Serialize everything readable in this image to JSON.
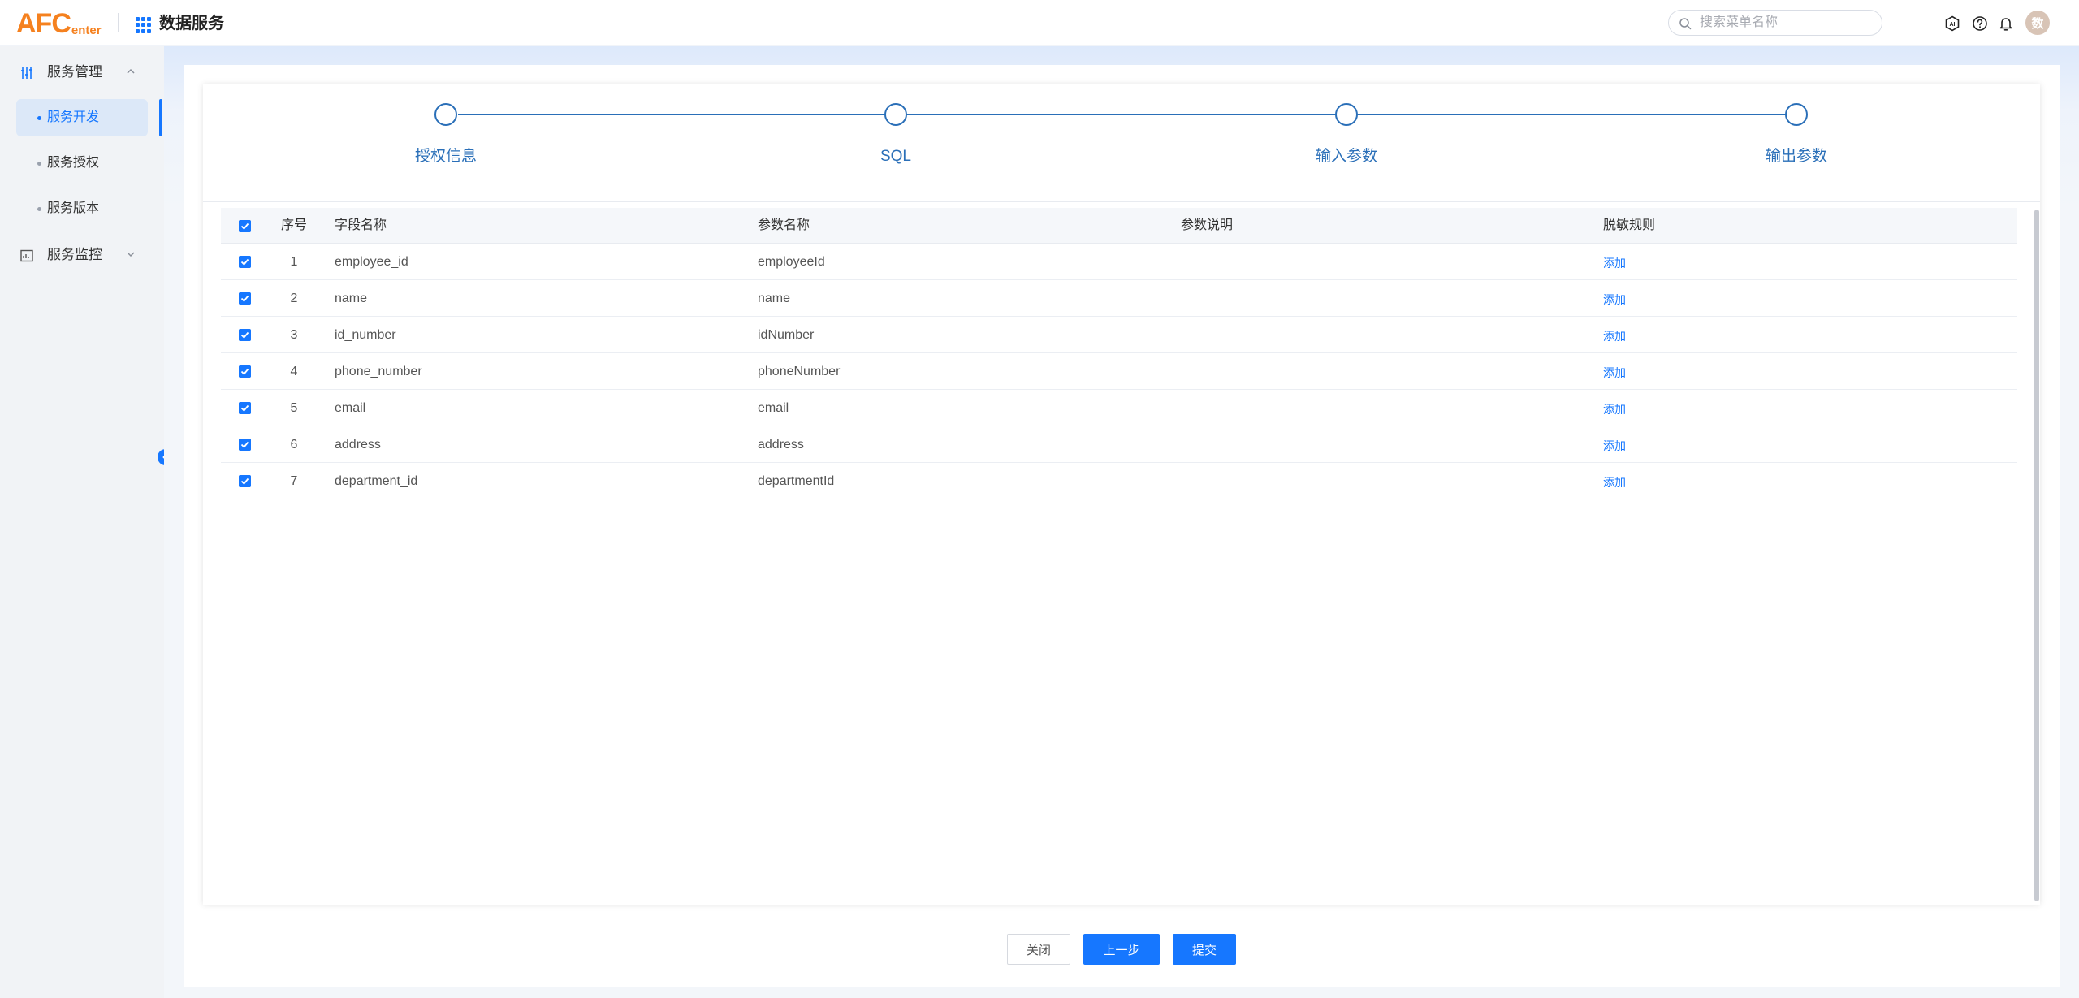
{
  "header": {
    "logo_main": "AFC",
    "logo_sub": "enter",
    "app_title": "数据服务",
    "search_placeholder": "搜索菜单名称",
    "avatar_text": "数"
  },
  "sidebar": {
    "groups": [
      {
        "label": "服务管理",
        "expanded": true
      },
      {
        "label": "服务监控",
        "expanded": false
      }
    ],
    "items": [
      {
        "label": "服务开发",
        "active": true
      },
      {
        "label": "服务授权",
        "active": false
      },
      {
        "label": "服务版本",
        "active": false
      }
    ]
  },
  "steps": [
    {
      "label": "授权信息"
    },
    {
      "label": "SQL"
    },
    {
      "label": "输入参数"
    },
    {
      "label": "输出参数"
    }
  ],
  "table": {
    "headers": {
      "index": "序号",
      "field_name": "字段名称",
      "param_name": "参数名称",
      "param_desc": "参数说明",
      "mask_rule": "脱敏规则"
    },
    "rows": [
      {
        "index": "1",
        "field": "employee_id",
        "param": "employeeId",
        "desc": "",
        "action": "添加",
        "checked": true
      },
      {
        "index": "2",
        "field": "name",
        "param": "name",
        "desc": "",
        "action": "添加",
        "checked": true
      },
      {
        "index": "3",
        "field": "id_number",
        "param": "idNumber",
        "desc": "",
        "action": "添加",
        "checked": true
      },
      {
        "index": "4",
        "field": "phone_number",
        "param": "phoneNumber",
        "desc": "",
        "action": "添加",
        "checked": true
      },
      {
        "index": "5",
        "field": "email",
        "param": "email",
        "desc": "",
        "action": "添加",
        "checked": true
      },
      {
        "index": "6",
        "field": "address",
        "param": "address",
        "desc": "",
        "action": "添加",
        "checked": true
      },
      {
        "index": "7",
        "field": "department_id",
        "param": "departmentId",
        "desc": "",
        "action": "添加",
        "checked": true
      }
    ]
  },
  "footer": {
    "close": "关闭",
    "prev": "上一步",
    "submit": "提交"
  },
  "colors": {
    "accent": "#1677ff",
    "step": "#2a6fb8",
    "logo": "#f5811f"
  }
}
